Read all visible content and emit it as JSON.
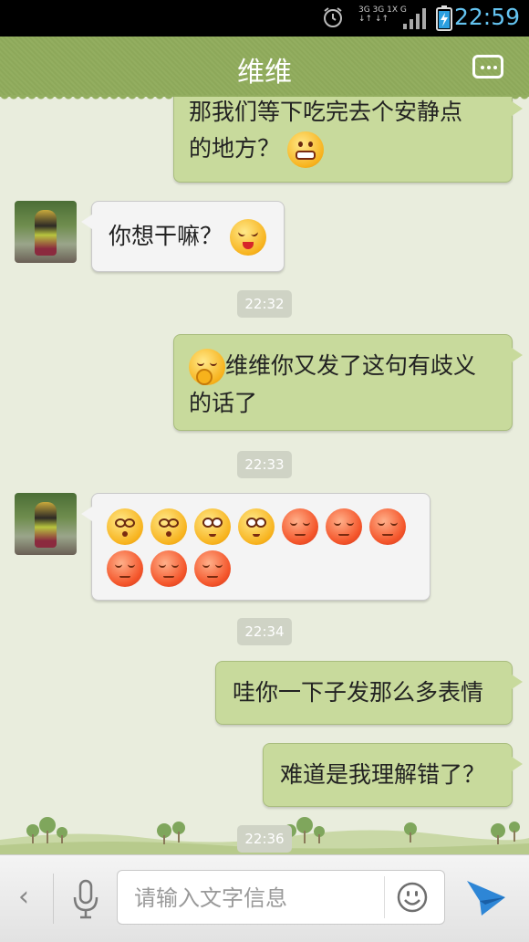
{
  "status_bar": {
    "time": "22:59",
    "network_top": "3G 3G 1X G",
    "network_bottom": "↓↑ ↓↑",
    "icons": [
      "alarm-icon",
      "signal-icon",
      "battery-charging-icon"
    ]
  },
  "header": {
    "title": "维维",
    "menu_icon": "more-icon"
  },
  "messages": [
    {
      "from": "me",
      "lines": [
        "那我们等下吃完去个安静点",
        "的地方？"
      ],
      "emoji_after": [
        "grin"
      ]
    },
    {
      "from": "other",
      "text": "你想干嘛？",
      "emoji_after": [
        "angry-tongue"
      ]
    },
    {
      "timestamp": "22:32"
    },
    {
      "from": "me",
      "lines": [
        "维维你又发了这句有歧义",
        "的话了"
      ],
      "emoji_before": [
        "thinking"
      ]
    },
    {
      "timestamp": "22:33"
    },
    {
      "from": "other",
      "emojis": [
        "dizzy",
        "dizzy",
        "confused",
        "confused",
        "sleepy-red",
        "sleepy-red",
        "sleepy-red",
        "sleepy-red",
        "sleepy-red",
        "sleepy-red"
      ]
    },
    {
      "timestamp": "22:34"
    },
    {
      "from": "me",
      "text": "哇你一下子发那么多表情"
    },
    {
      "from": "me",
      "text": "难道是我理解错了？"
    },
    {
      "timestamp": "22:36"
    }
  ],
  "input_bar": {
    "placeholder": "请输入文字信息",
    "back_symbol": "‹",
    "icons": [
      "back-icon",
      "microphone-icon",
      "emoji-icon",
      "send-icon"
    ]
  },
  "colors": {
    "header": "#8fab5c",
    "outgoing_bubble": "#c8da9c",
    "incoming_bubble": "#f4f4f4",
    "clock": "#64c3f0"
  }
}
